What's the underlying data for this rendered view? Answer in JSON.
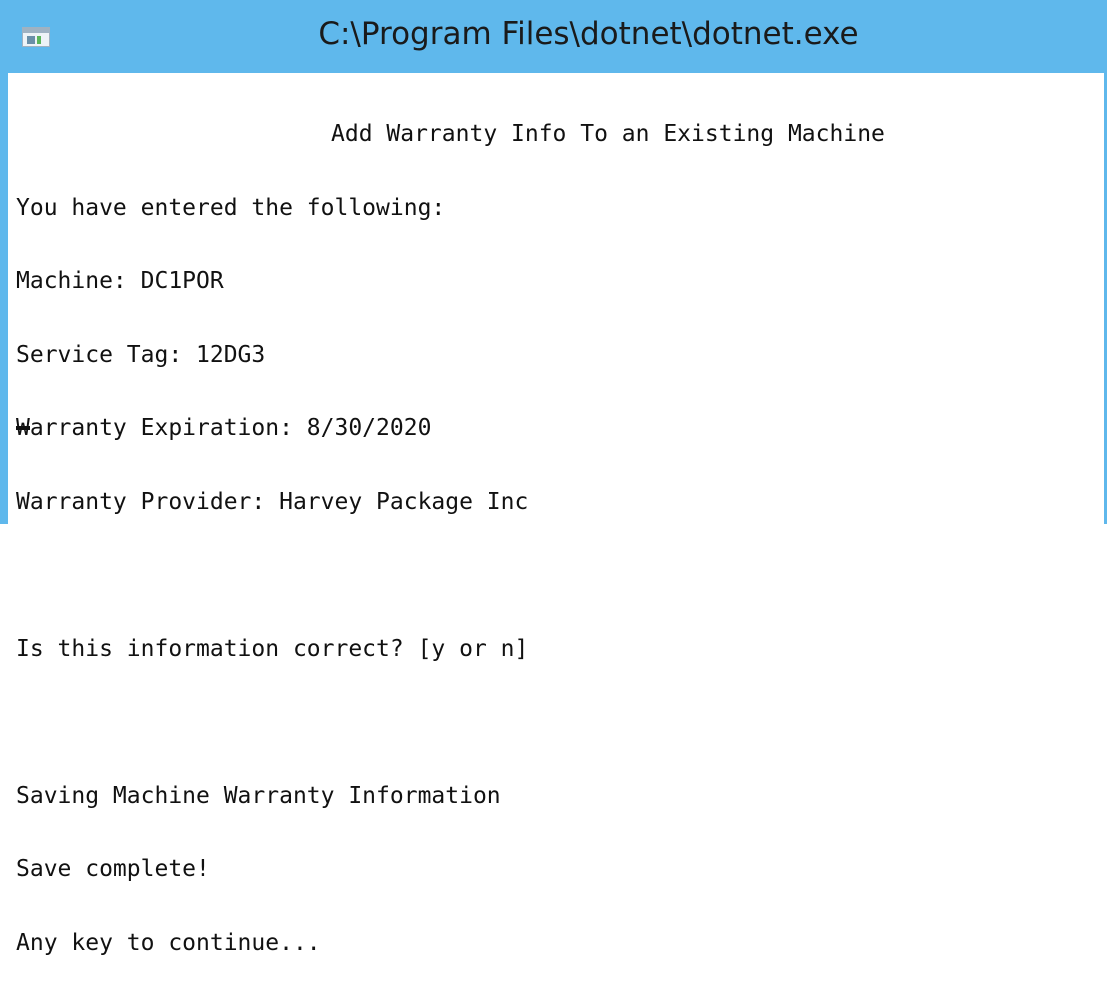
{
  "window": {
    "title": "C:\\Program Files\\dotnet\\dotnet.exe",
    "icon": "console-window-icon",
    "accent_color": "#5fb8ec"
  },
  "console": {
    "header": "Add Warranty Info To an Existing Machine",
    "entered_intro": "You have entered the following:",
    "machine": "Machine: DC1POR",
    "service_tag": "Service Tag: 12DG3",
    "warranty_expiration": "Warranty Expiration: 8/30/2020",
    "warranty_provider": "Warranty Provider: Harvey Package Inc",
    "confirm_prompt": "Is this information correct? [y or n]",
    "saving": "Saving Machine Warranty Information",
    "save_complete": "Save complete!",
    "continue_prompt": "Any key to continue..."
  }
}
